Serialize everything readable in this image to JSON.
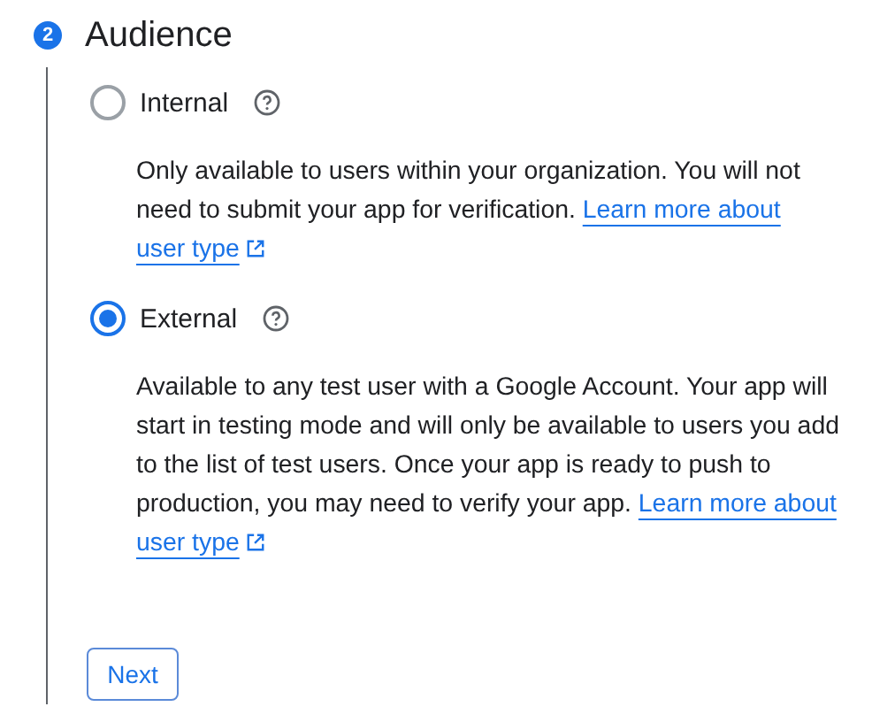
{
  "step": {
    "number": "2",
    "title": "Audience"
  },
  "options": [
    {
      "label": "Internal",
      "selected": false,
      "description": "Only available to users within your organization. You will not need to submit your app for verification.",
      "link": [
        "Learn more about",
        "user type"
      ]
    },
    {
      "label": "External",
      "selected": true,
      "description": "Available to any test user with a Google Account. Your app will start in testing mode and will only be available to users you add to the list of test users. Once your app is ready to push to production, you may need to verify your app.",
      "link": [
        "Learn more about",
        "user type"
      ]
    }
  ],
  "button": "Next"
}
